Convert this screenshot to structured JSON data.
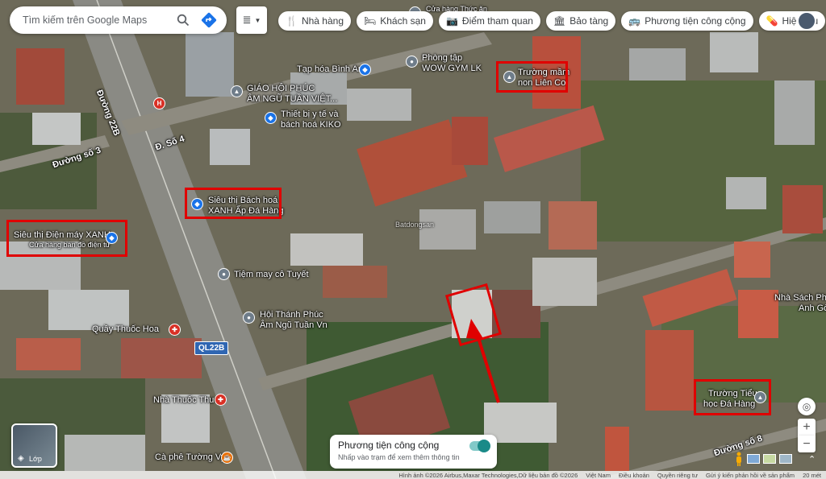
{
  "search": {
    "placeholder": "Tìm kiếm trên Google Maps"
  },
  "chips": [
    {
      "label": "Nhà hàng",
      "icon": "fork-knife-icon"
    },
    {
      "label": "Khách sạn",
      "icon": "bed-icon"
    },
    {
      "label": "Điểm tham quan",
      "icon": "camera-icon"
    },
    {
      "label": "Bảo tàng",
      "icon": "museum-icon"
    },
    {
      "label": "Phương tiện công cộng",
      "icon": "bus-icon"
    },
    {
      "label": "Hiệu thu",
      "icon": "pharmacy-icon"
    }
  ],
  "places": {
    "cua_hang": "Cửa hàng Thức ăn",
    "tap_hoa": "Tạp hóa Bình An",
    "phong_tap_1": "Phòng tập",
    "phong_tap_2": "WOW GYM LK",
    "giao_hoi_1": "GIÁO HỘI PHÚC",
    "giao_hoi_2": "ÂM NGŨ TUẦN VIỆT...",
    "thiet_bi_1": "Thiết bị y tế và",
    "thiet_bi_2": "bách hoá KIKO",
    "truong_mam_1": "Trường mầm",
    "truong_mam_2": "non Liên Cơ",
    "bhx_1": "Siêu thị Bách hoá",
    "bhx_2": "XANH Ấp Đá Hàng",
    "dmx_1": "Siêu thị Điện máy XANH",
    "dmx_2": "Cửa hàng bán đồ điện tử",
    "tiem_may": "Tiệm may cô Tuyết",
    "hoi_thanh_1": "Hội Thánh Phúc",
    "hoi_thanh_2": "Âm Ngũ Tuần Vn",
    "quay_thuoc": "Quầy Thuốc Hoa",
    "nha_thuoc": "Nhà Thuốc Thu",
    "ca_phe": "Cà phê Tường Vy",
    "truong_tieu_1": "Trường Tiểu",
    "truong_tieu_2": "học Đá Hàng",
    "nha_sach_1": "Nhà Sách Phú",
    "nha_sach_2": "Anh Gò",
    "watermark": "Batdongsan"
  },
  "roads": {
    "duong_22b": "Đường 22B",
    "d_so_4": "Đ. Số 4",
    "duong_so_3": "Đường số 3",
    "ql22b": "QL22B",
    "duong_so_8": "Đường số 8"
  },
  "layers": {
    "label": "Lớp"
  },
  "transit_card": {
    "title": "Phương tiện công cộng",
    "subtitle": "Nhấp vào trạm để xem thêm thông tin"
  },
  "attribution": {
    "imagery": "Hình ảnh ©2026 Airbus,Maxar Technologies,Dữ liệu bản đồ ©2026",
    "vietnam": "Việt Nam",
    "terms": "Điều khoản",
    "privacy": "Quyền riêng tư",
    "feedback": "Gửi ý kiến phản hồi về sản phẩm",
    "scale": "20 mét"
  },
  "colors": {
    "highlight": "#e00000",
    "pin_blue": "#1a73e8",
    "pin_gray": "#6f7d8a",
    "pin_red": "#d93025",
    "pin_orange": "#e8710a"
  }
}
